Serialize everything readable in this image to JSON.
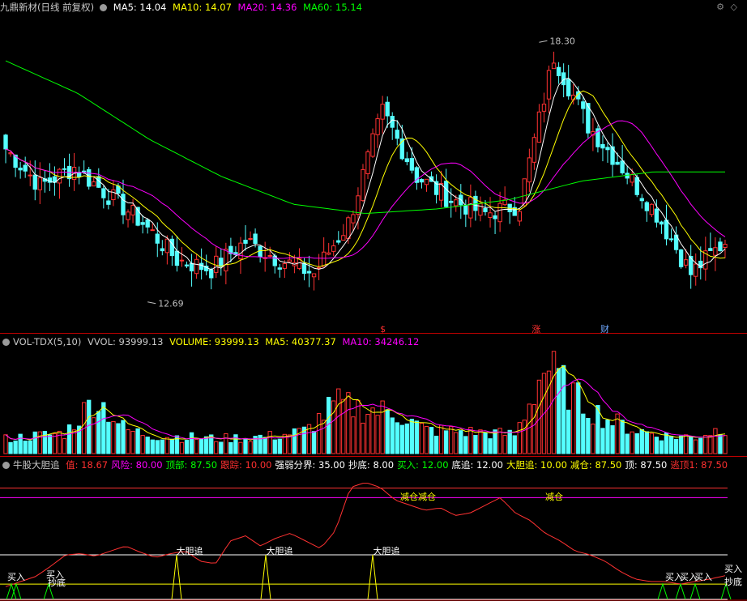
{
  "colors": {
    "up": "#ff3232",
    "down": "#54ffff",
    "ma5": "#ffffff",
    "ma10": "#ffff00",
    "ma20": "#ff00ff",
    "ma60": "#00ff00",
    "divider": "#c00000"
  },
  "header": {
    "title": "九鼎新材(日线 前复权)",
    "ma5": "MA5: 14.04",
    "ma10": "MA10: 14.07",
    "ma20": "MA20: 14.36",
    "ma60": "MA60: 15.14",
    "gear": "⚙",
    "diamond": "◇"
  },
  "vol_header": {
    "title": "VOL-TDX(5,10)",
    "vvol": "VVOL: 93999.13",
    "volume": "VOLUME: 93999.13",
    "ma5": "MA5: 40377.37",
    "ma10": "MA10: 34246.12"
  },
  "ind_header": {
    "title": "牛股大胆追",
    "items": [
      {
        "text": "值: 18.67",
        "color": "#ff3030"
      },
      {
        "text": "风险: 80.00",
        "color": "#ff00ff"
      },
      {
        "text": "顶部: 87.50",
        "color": "#00ff00"
      },
      {
        "text": "跟踪: 10.00",
        "color": "#ff3030"
      },
      {
        "text": "强弱分界: 35.00",
        "color": "#ffffff"
      },
      {
        "text": "抄底: 8.00",
        "color": "#ffffff"
      },
      {
        "text": "买入: 12.00",
        "color": "#00ff00"
      },
      {
        "text": "底追: 12.00",
        "color": "#ffffff"
      },
      {
        "text": "大胆追: 10.00",
        "color": "#ffff00"
      },
      {
        "text": "减仓: 87.50",
        "color": "#ffff00"
      },
      {
        "text": "顶: 87.50",
        "color": "#ffffff"
      },
      {
        "text": "逃顶1: 87.50",
        "color": "#ff3030"
      }
    ]
  },
  "price_labels": {
    "high": "18.30",
    "low": "12.69"
  },
  "markers": [
    {
      "text": "$",
      "color": "#ff3030"
    },
    {
      "text": "涨",
      "color": "#ff3030"
    },
    {
      "text": "财",
      "color": "#6fa8ff"
    }
  ],
  "chart_data": {
    "type": "candlestick",
    "candle_count": 148,
    "price_range": [
      12.3,
      18.9
    ],
    "extremes": {
      "high": 18.3,
      "low": 12.69
    },
    "key_prices": [
      16.0,
      15.2,
      15.6,
      15.0,
      14.4,
      13.6,
      13.4,
      14.0,
      13.6,
      13.3,
      14.4,
      16.8,
      15.4,
      14.9,
      14.6,
      14.8,
      18.0,
      16.5,
      15.6,
      14.6,
      13.3,
      14.0
    ],
    "volume_keys": [
      25,
      30,
      35,
      95,
      40,
      30,
      28,
      25,
      27,
      30,
      38,
      85,
      75,
      70,
      40,
      38,
      35,
      32,
      150,
      95,
      60,
      40,
      30,
      28,
      45
    ],
    "indicator": {
      "levels": {
        "risk": 80,
        "top": 87.5,
        "divide": 35,
        "chase": 10,
        "buy": 12
      },
      "value_keys": [
        10,
        14,
        18,
        26,
        35,
        36,
        34,
        38,
        42,
        37,
        33,
        36,
        38,
        30,
        28,
        46,
        50,
        42,
        48,
        52,
        46,
        40,
        54,
        88,
        92,
        88,
        78,
        74,
        70,
        72,
        66,
        68,
        74,
        80,
        68,
        62,
        52,
        46,
        38,
        35,
        30,
        22,
        16,
        14,
        14,
        12,
        14,
        16,
        18.67
      ]
    }
  },
  "ind_signals": [
    {
      "text": "买入",
      "color": "#ffffff"
    },
    {
      "text": "买入",
      "color": "#ffffff"
    },
    {
      "text": "抄底",
      "color": "#ffffff"
    },
    {
      "text": "大胆追",
      "color": "#ffffff"
    },
    {
      "text": "大胆追",
      "color": "#ffffff"
    },
    {
      "text": "大胆追",
      "color": "#ffffff"
    },
    {
      "text": "减仓",
      "color": "#ffff00"
    },
    {
      "text": "减仓",
      "color": "#ffff00"
    },
    {
      "text": "减仓",
      "color": "#ffff00"
    },
    {
      "text": "买入",
      "color": "#ffffff"
    },
    {
      "text": "买入",
      "color": "#ffffff"
    },
    {
      "text": "买入",
      "color": "#ffffff"
    },
    {
      "text": "买入",
      "color": "#ffffff"
    },
    {
      "text": "抄底",
      "color": "#ffffff"
    }
  ]
}
